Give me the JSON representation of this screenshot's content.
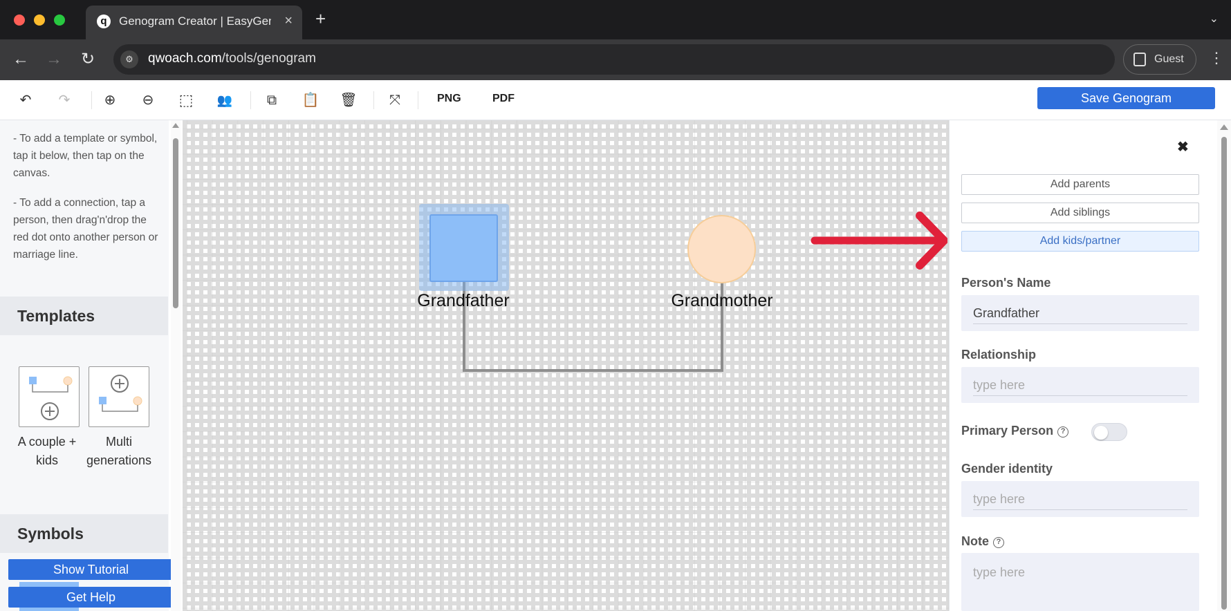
{
  "browser": {
    "tab_title": "Genogram Creator | EasyGen",
    "tab_favicon": "q",
    "url_domain": "qwoach.com",
    "url_path": "/tools/genogram",
    "profile_label": "Guest"
  },
  "toolbar": {
    "png_label": "PNG",
    "pdf_label": "PDF",
    "save_label": "Save Genogram",
    "icons": [
      "undo-icon",
      "redo-icon",
      "zoom-in-icon",
      "zoom-out-icon",
      "select-area-icon",
      "group-icon",
      "copy-icon",
      "paste-icon",
      "delete-icon",
      "fit-screen-icon"
    ]
  },
  "sidebar": {
    "help_1": "- To add a template or symbol, tap it below, then tap on the canvas.",
    "help_2": "- To add a connection, tap a person, then drag'n'drop the red dot onto another person or marriage line.",
    "templates_heading": "Templates",
    "templates": [
      {
        "label": "A couple + kids"
      },
      {
        "label": "Multi generations"
      }
    ],
    "symbols_heading": "Symbols",
    "show_tutorial": "Show Tutorial",
    "get_help": "Get Help"
  },
  "canvas": {
    "people": [
      {
        "name": "Grandfather",
        "shape": "square",
        "selected": true
      },
      {
        "name": "Grandmother",
        "shape": "circle",
        "selected": false
      }
    ],
    "colors": {
      "male": "#8dbef8",
      "female": "#fde0c6",
      "arrow": "#e0213a"
    }
  },
  "panel": {
    "close_icon": "close-icon",
    "add_parents": "Add parents",
    "add_siblings": "Add siblings",
    "add_kids_partner": "Add kids/partner",
    "name_label": "Person's Name",
    "name_value": "Grandfather",
    "relationship_label": "Relationship",
    "relationship_placeholder": "type here",
    "primary_label": "Primary Person",
    "primary_on": false,
    "gender_label": "Gender identity",
    "gender_placeholder": "type here",
    "note_label": "Note",
    "note_placeholder": "type here"
  }
}
